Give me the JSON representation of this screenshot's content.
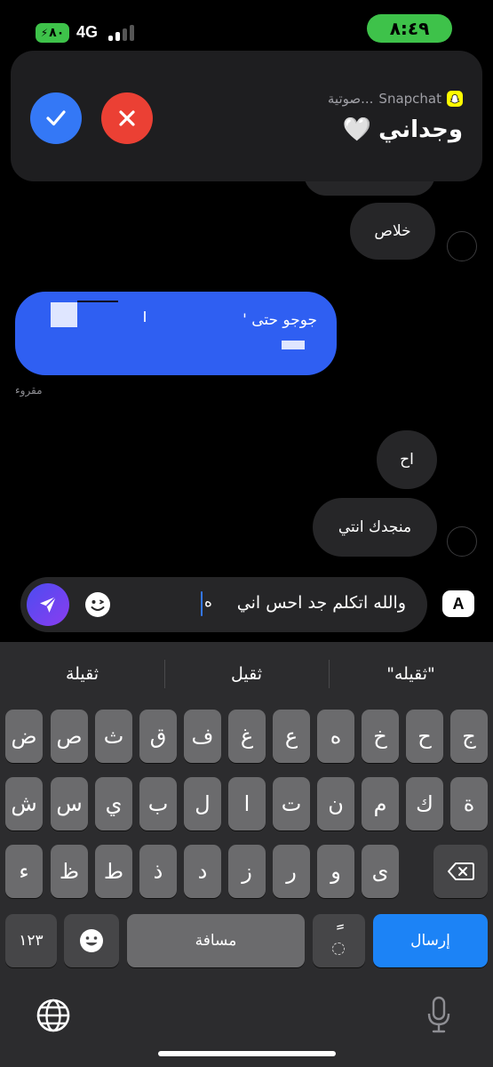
{
  "status_bar": {
    "time": "٨:٤٩",
    "network": "4G",
    "battery": "٨٠"
  },
  "notification": {
    "app_name": "Snapchat",
    "subtitle": "صوتية...",
    "title": "وجداني",
    "title_emoji": "🤍"
  },
  "messages": {
    "hidden_top": "",
    "khalas": "خلاص",
    "sent_text": "جوجو حتى '",
    "read_receipt": "مقروء",
    "ah": "اح",
    "manjadak": "منجدك انتي"
  },
  "composer": {
    "text": "والله اتكلم جد احس اني",
    "typed_letter": "ه",
    "format_button": "A"
  },
  "keyboard": {
    "suggestions": [
      "\"ثقيله\"",
      "ثقيل",
      "ثقيلة"
    ],
    "row1": [
      "ج",
      "ح",
      "خ",
      "ه",
      "ع",
      "غ",
      "ف",
      "ق",
      "ث",
      "ص",
      "ض"
    ],
    "row2": [
      "ة",
      "ك",
      "م",
      "ن",
      "ت",
      "ا",
      "ل",
      "ب",
      "ي",
      "س",
      "ش"
    ],
    "row3": [
      "ى",
      "و",
      "ر",
      "ز",
      "د",
      "ذ",
      "ط",
      "ظ",
      "ء"
    ],
    "numbers_label": "١٢٣",
    "space_label": "مسافة",
    "tanween_label": "ً",
    "return_label": "إرسال"
  },
  "colors": {
    "sent_bubble": "#2f5ff2",
    "received_bubble": "#262628",
    "accept": "#3478f6",
    "decline": "#eb4034",
    "status_green": "#3ec24a"
  }
}
